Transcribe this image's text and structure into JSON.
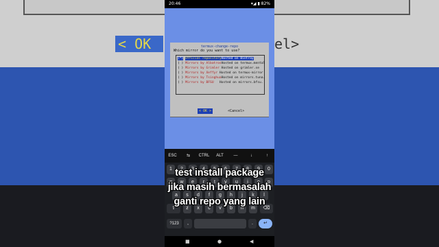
{
  "status": {
    "time": "20:46",
    "battery": "82%",
    "left_icons": "⊡ ✉ 👁 ⬤ ⬤ ·"
  },
  "dialog": {
    "title": "termux-change-repo",
    "question": "Which mirror do you want to use?",
    "options": [
      {
        "mark": "(*)",
        "name": "Official repository",
        "host": "Hosted on Bintray",
        "selected": true
      },
      {
        "mark": "( )",
        "name": "Mirrors by Albatros",
        "host": "Hosted on termux.mental",
        "selected": false
      },
      {
        "mark": "( )",
        "name": "Mirrors by Grimler",
        "host": "Hosted on grimler.se",
        "selected": false
      },
      {
        "mark": "( )",
        "name": "Mirrors by Xeffyr",
        "host": "Hosted on termux-mirror",
        "selected": false
      },
      {
        "mark": "( )",
        "name": "Mirrors by Tsinghua",
        "host": "Hosted on mirrors.tuna.",
        "selected": false
      },
      {
        "mark": "( )",
        "name": "Mirrors by BFSU",
        "host": "Hosted on mirrors.bfsu.",
        "selected": false
      }
    ],
    "ok_label": "< OK >",
    "cancel_label": "<Cancel>"
  },
  "background": {
    "ok_text": "< OK",
    "el_text": "el>"
  },
  "extra_keys": [
    "ESC",
    "⇆",
    "CTRL",
    "ALT",
    "—",
    "↓",
    "↑"
  ],
  "keyboard": {
    "row1": [
      "1",
      "2",
      "3",
      "4",
      "5",
      "6",
      "7",
      "8",
      "9",
      "0"
    ],
    "row2": [
      "q",
      "w",
      "e",
      "r",
      "t",
      "y",
      "u",
      "i",
      "o",
      "p"
    ],
    "row3": [
      "a",
      "s",
      "d",
      "f",
      "g",
      "h",
      "j",
      "k",
      "l"
    ],
    "row4": [
      "⇧",
      "z",
      "x",
      "c",
      "v",
      "b",
      "n",
      "m",
      "⌫"
    ],
    "row5": [
      "?123",
      ",",
      ".",
      "↵"
    ]
  },
  "nav": [
    "■",
    "●",
    "◀"
  ],
  "captions": [
    "test install package",
    "jika masih bermasalah",
    "ganti repo yang lain"
  ]
}
